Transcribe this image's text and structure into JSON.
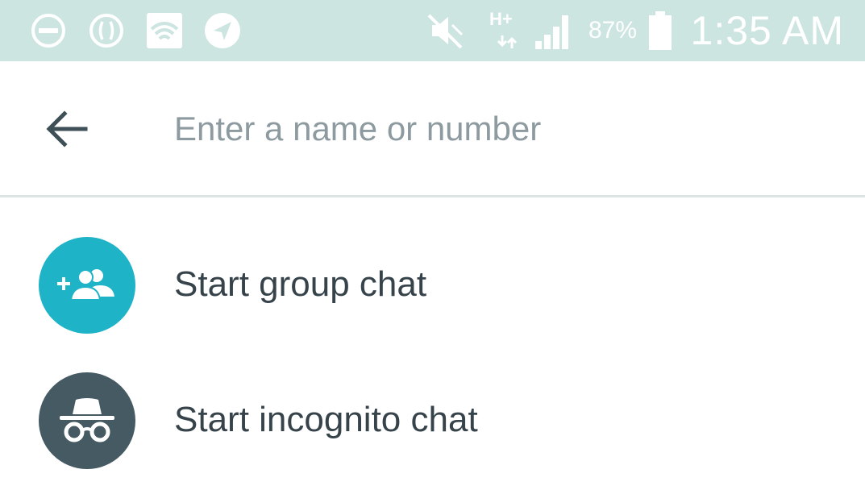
{
  "status_bar": {
    "network_type": "H+",
    "battery_percent": "87%",
    "time": "1:35 AM",
    "icons": [
      "do-not-disturb-icon",
      "vibrate-icon",
      "wifi-icon",
      "location-arrow-icon",
      "mute-icon",
      "signal-icon",
      "battery-icon"
    ]
  },
  "search": {
    "placeholder": "Enter a name or number",
    "value": ""
  },
  "list": {
    "items": [
      {
        "label": "Start group chat",
        "icon": "add-group-icon",
        "color": "#1fb3c8"
      },
      {
        "label": "Start incognito chat",
        "icon": "incognito-icon",
        "color": "#465a64"
      }
    ]
  },
  "colors": {
    "status_bar_bg": "#cde5e1",
    "text_primary": "#36434a",
    "text_placeholder": "#8d9aa0",
    "divider": "#dde5e4"
  }
}
